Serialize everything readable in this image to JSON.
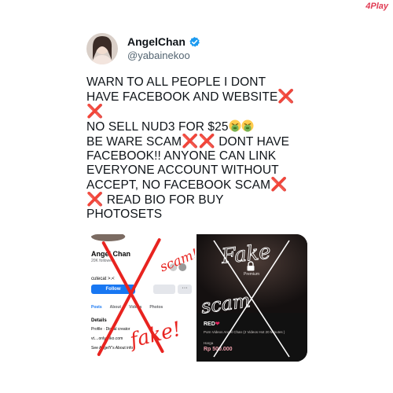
{
  "watermark": "4Play",
  "author": {
    "display_name": "AngelChan",
    "handle": "@yabainekoo",
    "verified": true
  },
  "tweet": {
    "lines": [
      "WARN TO ALL PEOPLE I DONT",
      "HAVE FACEBOOK AND WEBSITE",
      "",
      "NO SELL NUD3 FOR $25",
      "BE WARE SCAM",
      "DONT HAVE",
      "FACEBOOK!! ANYONE CAN LINK",
      "EVERYONE ACCOUNT WITHOUT",
      "ACCEPT, NO FACEBOOK SCAM",
      "READ BIO FOR BUY",
      "PHOTOSETS"
    ],
    "emoji": {
      "cross": "❌",
      "nausea": "nauseated-face"
    }
  },
  "media": {
    "left": {
      "profile_name": "Angel Chan",
      "followers": "20K followers",
      "bio": "cutecat >.<",
      "follow_label": "Follow",
      "more_label": "···",
      "tabs": [
        "Posts",
        "About",
        "Videos",
        "Photos"
      ],
      "details_title": "Details",
      "detail_1": "Profile · Digital creator",
      "detail_2": "vt....onlyanko.com",
      "detail_3": "See AngelY's About info",
      "annotations": [
        "scam!",
        "fake!"
      ]
    },
    "right": {
      "premium_label": "Premium",
      "item_title": "RED",
      "item_desc": "Porn Videos Angel Chan (2 Videos Hot 20 Minutes )",
      "price_label": "Harga",
      "price": "Rp 500.000",
      "annotations": [
        "Fake",
        "scam"
      ]
    },
    "annotation_color": "#e8231f"
  }
}
